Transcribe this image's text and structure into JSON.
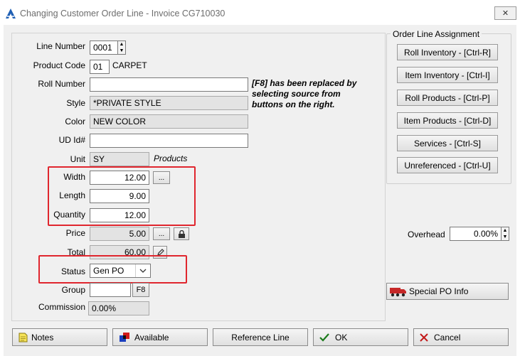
{
  "window": {
    "title": "Changing Customer Order Line - Invoice CG710030",
    "close_glyph": "✕"
  },
  "form": {
    "line_number": {
      "label": "Line Number",
      "value": "0001"
    },
    "product_code": {
      "label": "Product Code",
      "code": "01",
      "name": "CARPET"
    },
    "roll_number": {
      "label": "Roll Number",
      "value": ""
    },
    "style": {
      "label": "Style",
      "value": "*PRIVATE STYLE"
    },
    "color": {
      "label": "Color",
      "value": "NEW COLOR"
    },
    "ud_id": {
      "label": "UD Id#",
      "value": ""
    },
    "unit": {
      "label": "Unit",
      "value": "SY",
      "note": "Products"
    },
    "width": {
      "label": "Width",
      "value": "12.00",
      "button": "..."
    },
    "length": {
      "label": "Length",
      "value": "9.00"
    },
    "quantity": {
      "label": "Quantity",
      "value": "12.00"
    },
    "price": {
      "label": "Price",
      "value": "5.00",
      "button": "..."
    },
    "total": {
      "label": "Total",
      "value": "60.00"
    },
    "status": {
      "label": "Status",
      "value": "Gen PO"
    },
    "group": {
      "label": "Group",
      "value": "",
      "button": "F8"
    },
    "commission": {
      "label": "Commission",
      "value": "0.00%"
    },
    "f8_note": [
      "[F8] has been replaced by",
      "selecting source from",
      "buttons on the right."
    ]
  },
  "assignment": {
    "title": "Order Line Assignment",
    "buttons": [
      "Roll Inventory - [Ctrl-R]",
      "Item Inventory - [Ctrl-I]",
      "Roll Products - [Ctrl-P]",
      "Item Products - [Ctrl-D]",
      "Services - [Ctrl-S]",
      "Unreferenced - [Ctrl-U]"
    ]
  },
  "overhead": {
    "label": "Overhead",
    "value": "0.00%"
  },
  "special_po": {
    "label": "Special PO Info"
  },
  "footer": {
    "notes": "Notes",
    "available": "Available",
    "reference_line": "Reference Line",
    "ok": "OK",
    "cancel": "Cancel"
  },
  "colors": {
    "highlight_box": "#e0262e",
    "title_text": "#6d6d6d",
    "ok_check": "#1a7a1a",
    "cancel_x": "#c21818"
  }
}
